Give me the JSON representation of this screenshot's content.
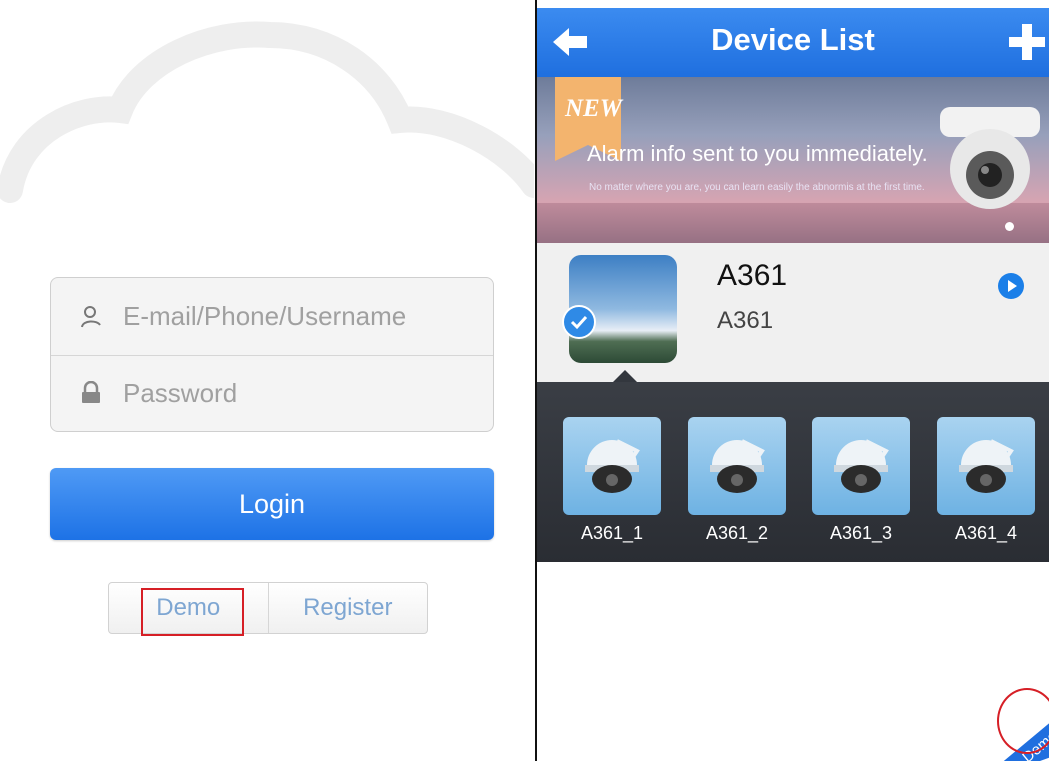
{
  "login": {
    "username_placeholder": "E-mail/Phone/Username",
    "password_placeholder": "Password",
    "login_label": "Login",
    "demo_label": "Demo",
    "register_label": "Register"
  },
  "device_list": {
    "title": "Device List",
    "banner": {
      "badge": "NEW",
      "headline": "Alarm info sent to you immediately.",
      "subtext": "No matter where you are, you can learn easily the abnormis at the first time."
    },
    "device": {
      "name": "A361",
      "subtitle": "A361"
    },
    "channels": [
      "A361_1",
      "A361_2",
      "A361_3",
      "A361_4"
    ],
    "corner_badge": "Demo"
  },
  "colors": {
    "primary_blue": "#1f6fdf",
    "highlight_red": "#d61f26",
    "link_blue": "#7ea6d2"
  }
}
